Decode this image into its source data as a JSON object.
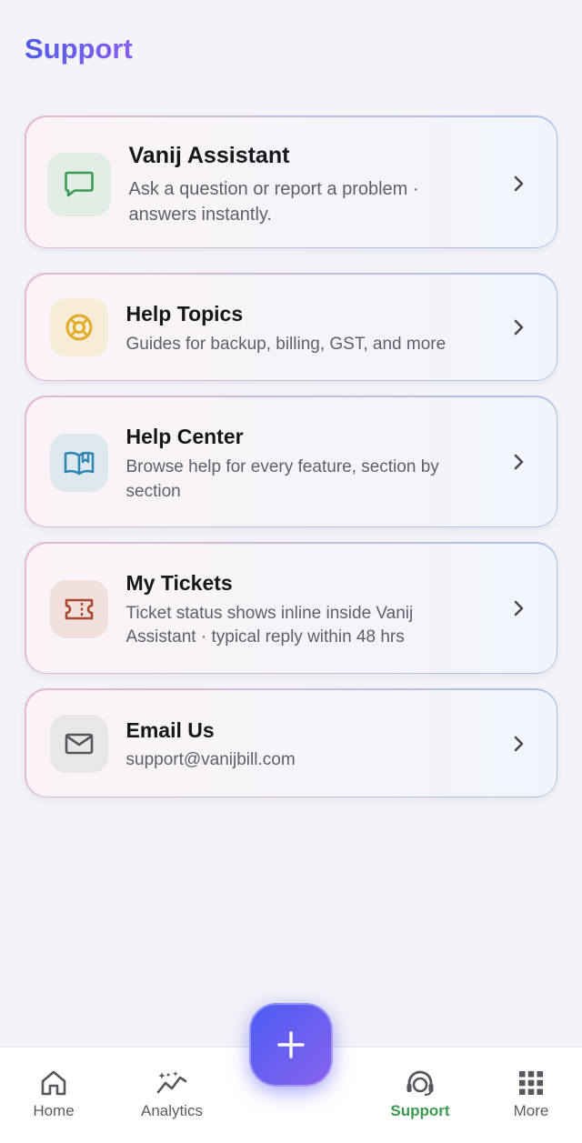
{
  "header": {
    "title": "Support"
  },
  "cards": [
    {
      "title": "Vanij Assistant",
      "subtitle_lines": [
        "Ask a question or report a problem ·",
        "answers instantly."
      ],
      "icon": "chat-bubble-icon"
    },
    {
      "title": "Help Topics",
      "subtitle_lines": [
        "Guides for backup, billing, GST, and more"
      ],
      "icon": "lifebuoy-icon"
    },
    {
      "title": "Help Center",
      "subtitle_lines": [
        "Browse help for every feature, section by",
        "section"
      ],
      "icon": "open-book-icon"
    },
    {
      "title": "My Tickets",
      "subtitle_lines": [
        "Ticket status shows inline inside Vanij",
        "Assistant · typical reply within 48 hrs"
      ],
      "icon": "ticket-icon"
    },
    {
      "title": "Email Us",
      "subtitle_lines": [
        "support@vanijbill.com"
      ],
      "icon": "mail-icon"
    }
  ],
  "nav": {
    "items": [
      {
        "label": "Home",
        "icon": "home-icon"
      },
      {
        "label": "Analytics",
        "icon": "analytics-icon"
      },
      {
        "label": "Support",
        "icon": "headset-icon",
        "active": true
      },
      {
        "label": "More",
        "icon": "grid-icon"
      }
    ],
    "fab_icon": "plus-icon"
  },
  "colors": {
    "accent": "#4f5ce6",
    "active_nav": "#3e9a50",
    "background": "#f3f3f8"
  }
}
